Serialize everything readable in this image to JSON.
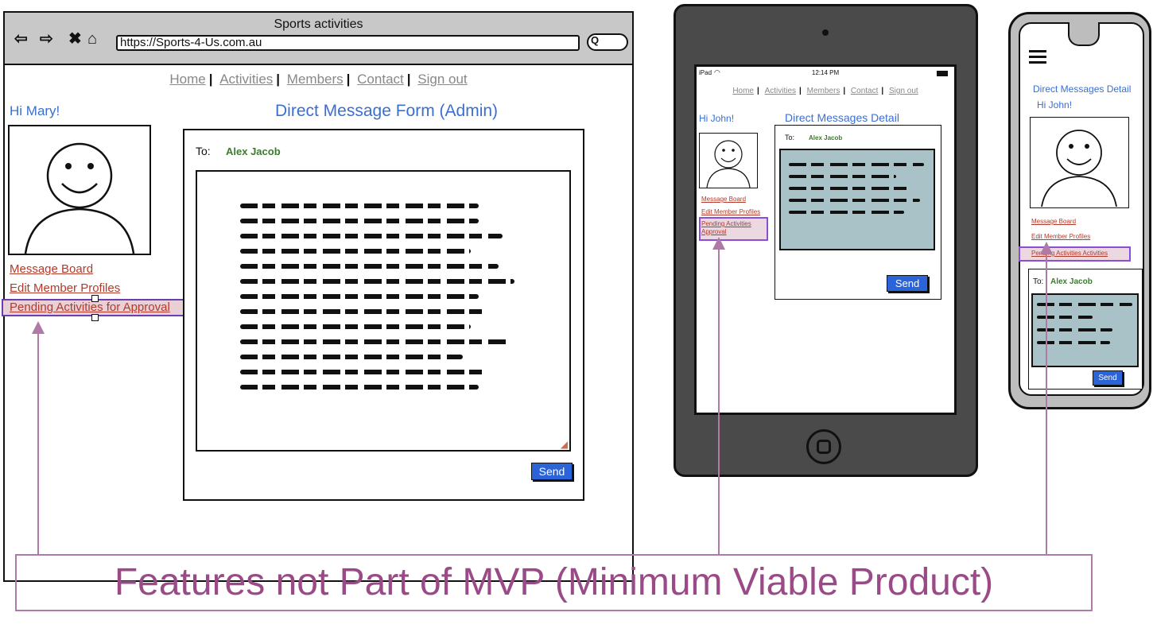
{
  "desktop": {
    "window_title": "Sports activities",
    "nav_back": "⇦",
    "nav_forward": "⇨",
    "nav_stop": "✖",
    "nav_home": "⌂",
    "url": "https://Sports-4-Us.com.au",
    "search_symbol": "Q",
    "nav": [
      "Home",
      "Activities",
      "Members",
      "Contact",
      "Sign out"
    ],
    "greeting": "Hi Mary!",
    "page_title": "Direct Message Form (Admin)",
    "menu": [
      "Message Board",
      "Edit Member Profiles",
      "Pending Activities for Approval"
    ],
    "to_label": "To:",
    "to_name": "Alex Jacob",
    "send": "Send"
  },
  "tablet": {
    "status_left": "iPad",
    "status_time": "12:14 PM",
    "nav": [
      "Home",
      "Activities",
      "Members",
      "Contact",
      "Sign out"
    ],
    "greeting": "Hi John!",
    "page_title": "Direct Messages Detail",
    "menu": [
      "Message Board",
      "Edit Member Profiles",
      "Pending Activities Approval"
    ],
    "to_label": "To:",
    "to_name": "Alex Jacob",
    "send": "Send"
  },
  "phone": {
    "page_title": "Direct Messages Detail",
    "greeting": "Hi John!",
    "menu": [
      "Message Board",
      "Edit Member Profiles",
      "Pending Activities Activities"
    ],
    "to_label": "To:",
    "to_name": "Alex Jacob",
    "send": "Send"
  },
  "annotation": "Features not Part of MVP (Minimum Viable Product)",
  "colors": {
    "accent_blue": "#3a6fd1",
    "link_red": "#b33a2a",
    "annotation_purple": "#9a4b87",
    "highlight_violet": "#8a4fd6",
    "message_bg": "#a9c2c8"
  }
}
